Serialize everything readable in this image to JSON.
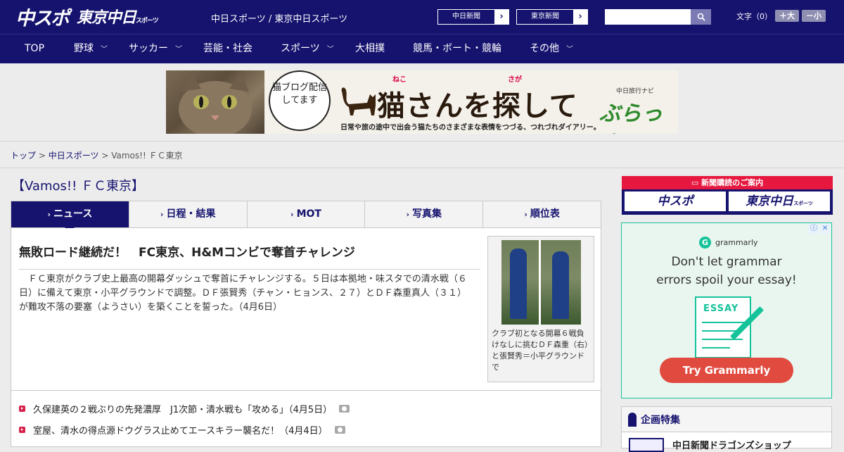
{
  "header": {
    "logo_chuspo": "中スポ",
    "logo_tokyo": "東京中日",
    "logo_tokyo_small": "スポーツ",
    "site_title": "中日スポーツ / 東京中日スポーツ",
    "btn_chunichi": "中日新聞",
    "btn_tokyo": "東京新聞",
    "arrow": "›",
    "search_placeholder": "",
    "font_label": "文字（0）",
    "font_bigger": "＋大",
    "font_smaller": "－小"
  },
  "nav": {
    "items": [
      {
        "label": "TOP",
        "chevron": ""
      },
      {
        "label": "野球",
        "chevron": "﹀"
      },
      {
        "label": "サッカー",
        "chevron": "﹀"
      },
      {
        "label": "芸能・社会",
        "chevron": ""
      },
      {
        "label": "スポーツ",
        "chevron": "﹀"
      },
      {
        "label": "大相撲",
        "chevron": ""
      },
      {
        "label": "競馬・ボート・競輪",
        "chevron": ""
      },
      {
        "label": "その他",
        "chevron": "﹀"
      }
    ]
  },
  "banner": {
    "bubble": "猫ブログ配信してます",
    "title": "猫さんを探して",
    "ruby_neko": "ねこ",
    "ruby_saga": "さが",
    "subtitle": "日常や旅の途中で出会う猫たちのさまざまな表情をつづる、つれづれダイアリー。",
    "brand": "ぶらっ人",
    "brand_sub": "中日旅行ナビ"
  },
  "breadcrumb": {
    "home": "トップ",
    "sep": ">",
    "section": "中日スポーツ",
    "current": "Vamos!! ＦＣ東京"
  },
  "main": {
    "heading": "【Vamos!! ＦＣ東京】",
    "tabs": [
      {
        "label": "ニュース",
        "active": true
      },
      {
        "label": "日程・結果",
        "active": false
      },
      {
        "label": "MOT",
        "active": false
      },
      {
        "label": "写真集",
        "active": false
      },
      {
        "label": "順位表",
        "active": false
      }
    ],
    "tab_arrow": "›",
    "article": {
      "title": "無敗ロード継続だ！　FC東京、H&Mコンビで奪首チャレンジ",
      "body": "ＦＣ東京がクラブ史上最高の開幕ダッシュで奪首にチャレンジする。５日は本拠地・味スタでの清水戦（６日）に備えて東京・小平グラウンドで調整。ＤＦ張賢秀（チャン・ヒョンス、２７）とＤＦ森重真人（３１）が難攻不落の要塞（ようさい）を築くことを誓った。（4月6日）",
      "photo_caption": "クラブ初となる開幕６戦負けなしに挑むＤＦ森重（右）と張賢秀＝小平グラウンドで"
    },
    "news": [
      {
        "text": "久保建英の２戦ぶりの先発濃厚　J1次節・清水戦も「攻める」（4月5日）"
      },
      {
        "text": "室屋、清水の得点源ドウグラス止めてエースキラー襲名だ！（4月4日）"
      }
    ]
  },
  "sidebar": {
    "subscribe_title": "新聞購読のご案内",
    "sub_chuspo": "中スポ",
    "sub_tokyo": "東京中日",
    "sub_tokyo_small": "スポーツ",
    "ad": {
      "brand": "grammarly",
      "headline_1": "Don't let grammar",
      "headline_2": "errors spoil your essay!",
      "essay_label": "ESSAY",
      "cta": "Try Grammarly",
      "info": "ⓘ",
      "close": "✕"
    },
    "feature_title": "企画特集",
    "feature_item": "中日新聞ドラゴンズショップ"
  }
}
